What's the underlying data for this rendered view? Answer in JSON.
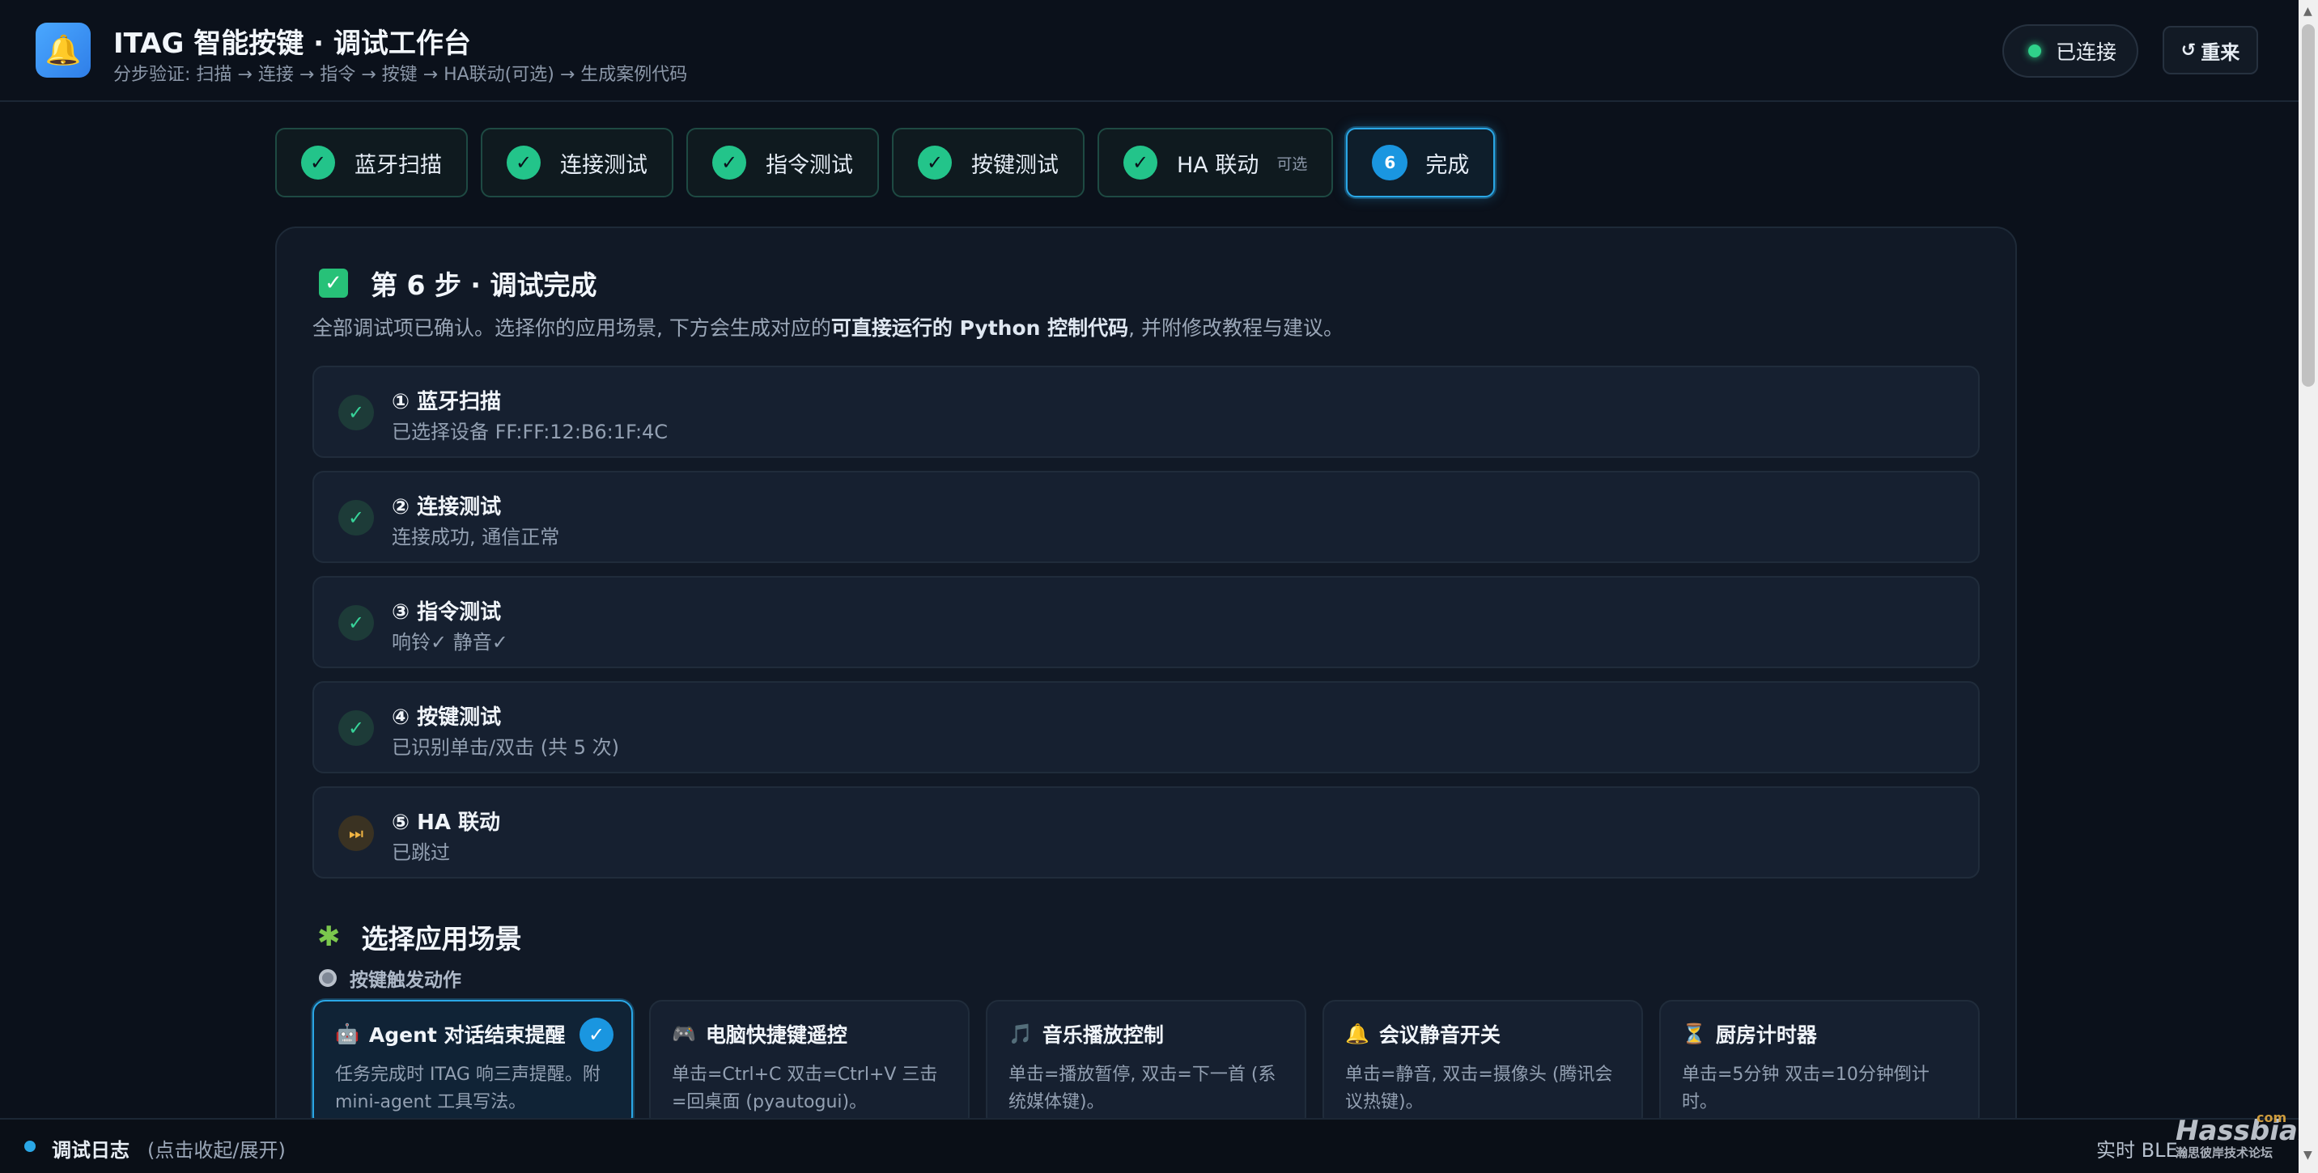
{
  "header": {
    "logo_icon": "bell-icon",
    "title": "ITAG 智能按键 · 调试工作台",
    "subtitle": "分步验证: 扫描 → 连接 → 指令 → 按键 → HA联动(可选) → 生成案例代码",
    "status": "已连接",
    "restart_label": "重来",
    "colors": {
      "connected": "#2fd18a",
      "accent": "#2aa7e6"
    }
  },
  "steps": [
    {
      "label": "蓝牙扫描",
      "state": "done"
    },
    {
      "label": "连接测试",
      "state": "done"
    },
    {
      "label": "指令测试",
      "state": "done"
    },
    {
      "label": "按键测试",
      "state": "done"
    },
    {
      "label": "HA 联动",
      "optional": "可选",
      "state": "done"
    },
    {
      "label": "完成",
      "number": "6",
      "state": "active"
    }
  ],
  "summary": {
    "title": "第 6 步 · 调试完成",
    "desc_pre": "全部调试项已确认。选择你的应用场景, 下方会生成对应的",
    "desc_bold": "可直接运行的 Python 控制代码",
    "desc_post": ", 并附修改教程与建议。",
    "items": [
      {
        "title": "① 蓝牙扫描",
        "detail": "已选择设备 FF:FF:12:B6:1F:4C",
        "status": "ok"
      },
      {
        "title": "② 连接测试",
        "detail": "连接成功, 通信正常",
        "status": "ok"
      },
      {
        "title": "③ 指令测试",
        "detail": "响铃✓ 静音✓",
        "status": "ok"
      },
      {
        "title": "④ 按键测试",
        "detail": "已识别单击/双击 (共 5 次)",
        "status": "ok"
      },
      {
        "title": "⑤ HA 联动",
        "detail": "已跳过",
        "status": "skipped"
      }
    ]
  },
  "scenarios": {
    "title": "选择应用场景",
    "trigger_label": "按键触发动作",
    "items": [
      {
        "emoji": "🤖",
        "title": "Agent 对话结束提醒",
        "desc": "任务完成时 ITAG 响三声提醒。附 mini-agent 工具写法。",
        "selected": true
      },
      {
        "emoji": "🎮",
        "title": "电脑快捷键遥控",
        "desc": "单击=Ctrl+C 双击=Ctrl+V 三击=回桌面 (pyautogui)。",
        "selected": false
      },
      {
        "emoji": "🎵",
        "title": "音乐播放控制",
        "desc": "单击=播放暂停, 双击=下一首 (系统媒体键)。",
        "selected": false
      },
      {
        "emoji": "🔔",
        "title": "会议静音开关",
        "desc": "单击=静音, 双击=摄像头 (腾讯会议热键)。",
        "selected": false
      },
      {
        "emoji": "⏳",
        "title": "厨房计时器",
        "desc": "单击=5分钟 双击=10分钟倒计时。",
        "selected": false
      }
    ]
  },
  "log": {
    "title": "调试日志",
    "hint": "(点击收起/展开)",
    "right": "实时 BLE"
  },
  "watermark": {
    "brand": "Hassbian",
    "tld": "com",
    "tagline": "瀚思彼岸技术论坛"
  }
}
